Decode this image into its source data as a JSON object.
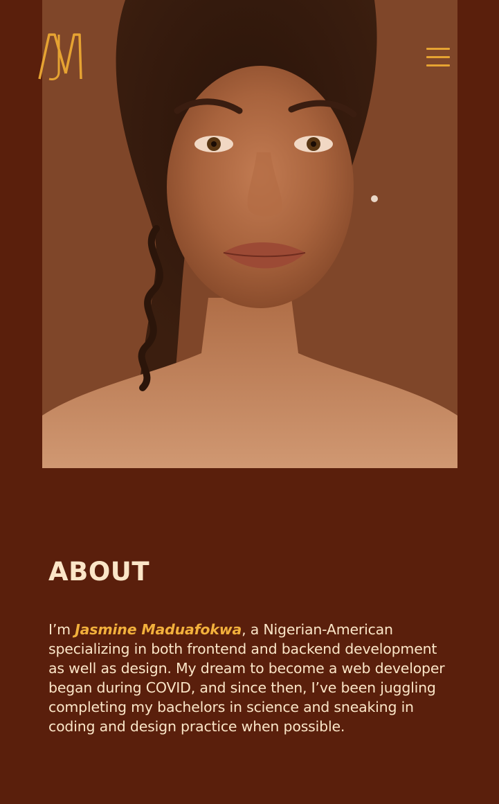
{
  "header": {
    "logo_alt": "JM",
    "menu_icon": "hamburger-menu-icon"
  },
  "hero": {
    "photo": "portrait-photo"
  },
  "about": {
    "heading": "ABOUT",
    "intro": "I’m ",
    "name": "Jasmine Maduafokwa",
    "body": ", a Nigerian-American specializing in both frontend and backend development as well as design. My dream to become a web developer began during COVID, and since then, I’ve been juggling completing my bachelors in science and sneaking in coding and design practice when possible."
  },
  "colors": {
    "background": "#5a1f0c",
    "accent": "#f2b03c",
    "text": "#fbe6c8"
  }
}
